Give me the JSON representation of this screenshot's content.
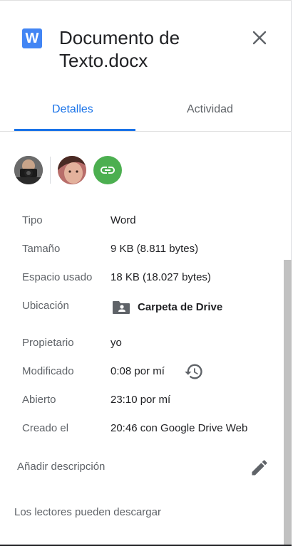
{
  "header": {
    "doc_icon_letter": "W",
    "title_line1": "Documento de",
    "title_line2": "Texto.docx",
    "close_icon": "close-icon"
  },
  "tabs": [
    {
      "label": "Detalles",
      "active": true
    },
    {
      "label": "Actividad",
      "active": false
    }
  ],
  "details": [
    {
      "label": "Tipo",
      "value": "Word"
    },
    {
      "label": "Tamaño",
      "value": "9 KB (8.811 bytes)"
    },
    {
      "label": "Espacio usado",
      "value": "18 KB (18.027 bytes)"
    },
    {
      "label": "Ubicación",
      "value": "Carpeta de Drive"
    },
    {
      "label": "Propietario",
      "value": "yo"
    },
    {
      "label": "Modificado",
      "value": "0:08 por mí"
    },
    {
      "label": "Abierto",
      "value": "23:10 por mí"
    },
    {
      "label": "Creado el",
      "value": "20:46 con Google Drive Web"
    }
  ],
  "description_placeholder": "Añadir descripción",
  "readers_text": "Los lectores pueden descargar",
  "colors": {
    "accent": "#1a73e8",
    "word_icon": "#4285f4",
    "link_avatar": "#4caf50"
  }
}
